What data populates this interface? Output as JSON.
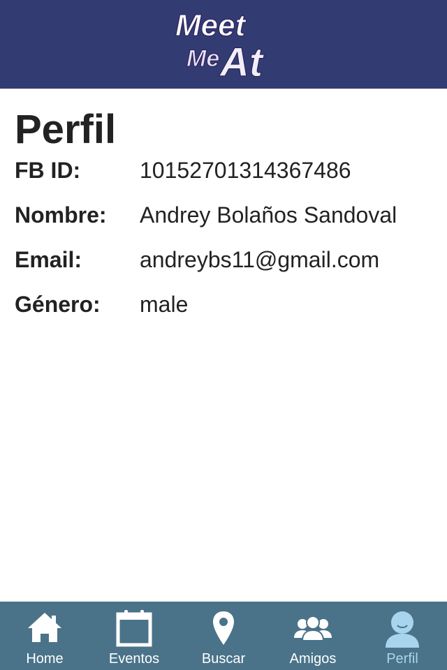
{
  "header": {
    "logo_text": "Meet Me At",
    "logo_line1": "Meet",
    "logo_line2": "Me",
    "logo_line3": "At"
  },
  "profile": {
    "title": "Perfil",
    "fields": [
      {
        "label": "FB ID:",
        "value": "10152701314367486"
      },
      {
        "label": "Nombre:",
        "value": "Andrey Bolaños Sandoval"
      },
      {
        "label": "Email:",
        "value": "andreybs11@gmail.com"
      },
      {
        "label": "Género:",
        "value": "male"
      }
    ]
  },
  "tabbar": {
    "tabs": [
      {
        "label": "Home",
        "icon": "home-icon",
        "active": false
      },
      {
        "label": "Eventos",
        "icon": "calendar-icon",
        "active": false
      },
      {
        "label": "Buscar",
        "icon": "map-pin-icon",
        "active": false
      },
      {
        "label": "Amigos",
        "icon": "group-icon",
        "active": false
      },
      {
        "label": "Perfil",
        "icon": "user-icon",
        "active": true
      }
    ]
  },
  "colors": {
    "header_bg": "#323c73",
    "tabbar_bg": "#4a7389",
    "tab_active": "#a8d4ee",
    "tab_inactive": "#ffffff",
    "text": "#222222"
  }
}
